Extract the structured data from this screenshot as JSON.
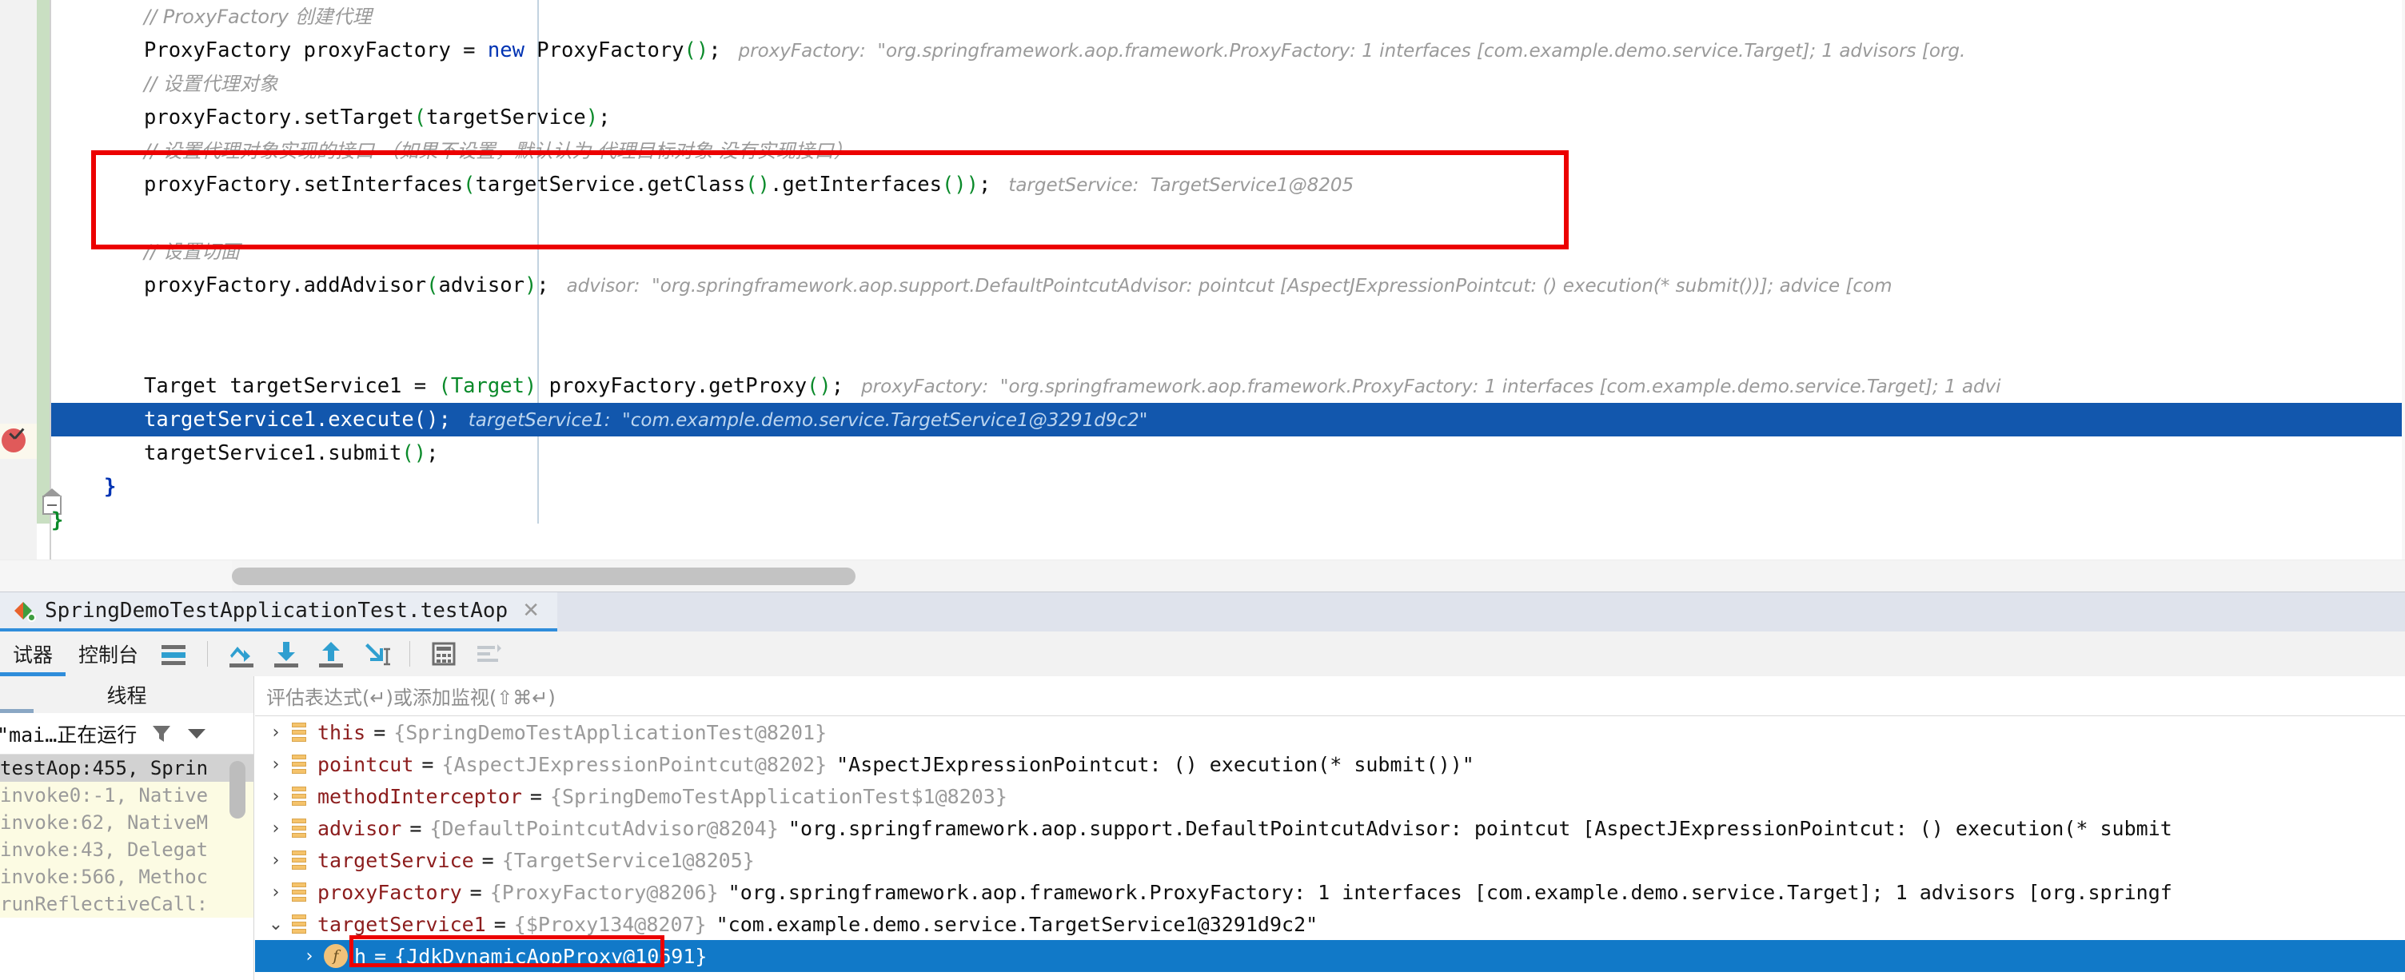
{
  "editor": {
    "lines": [
      {
        "indent": 0,
        "type": "comment",
        "text": "// ProxyFactory 创建代理"
      },
      {
        "indent": 0,
        "type": "code",
        "segments": [
          {
            "t": "plain",
            "v": "ProxyFactory proxyFactory = "
          },
          {
            "t": "kw",
            "v": "new"
          },
          {
            "t": "plain",
            "v": " ProxyFactory"
          },
          {
            "t": "paren",
            "v": "()"
          },
          {
            "t": "plain",
            "v": ";"
          }
        ],
        "hint": "proxyFactory:  \"org.springframework.aop.framework.ProxyFactory: 1 interfaces [com.example.demo.service.Target]; 1 advisors [org."
      },
      {
        "indent": 0,
        "type": "comment",
        "text": "// 设置代理对象"
      },
      {
        "indent": 0,
        "type": "code",
        "segments": [
          {
            "t": "plain",
            "v": "proxyFactory.setTarget"
          },
          {
            "t": "paren",
            "v": "("
          },
          {
            "t": "plain",
            "v": "targetService"
          },
          {
            "t": "paren",
            "v": ")"
          },
          {
            "t": "plain",
            "v": ";"
          }
        ],
        "hint": ""
      },
      {
        "indent": 0,
        "type": "comment",
        "text": "// 设置代理对象实现的接口 （如果不设置，默认认为 代理目标对象 没有实现接口）"
      },
      {
        "indent": 0,
        "type": "code",
        "segments": [
          {
            "t": "plain",
            "v": "proxyFactory.setInterfaces"
          },
          {
            "t": "paren",
            "v": "("
          },
          {
            "t": "plain",
            "v": "targetService.getClass"
          },
          {
            "t": "paren",
            "v": "()"
          },
          {
            "t": "plain",
            "v": ".getInterfaces"
          },
          {
            "t": "paren",
            "v": "()"
          },
          {
            "t": "paren",
            "v": ")"
          },
          {
            "t": "plain",
            "v": ";"
          }
        ],
        "hint": "targetService:  TargetService1@8205"
      },
      {
        "indent": 0,
        "type": "blank",
        "text": ""
      },
      {
        "indent": 0,
        "type": "comment",
        "text": "// 设置切面"
      },
      {
        "indent": 0,
        "type": "code",
        "segments": [
          {
            "t": "plain",
            "v": "proxyFactory.addAdvisor"
          },
          {
            "t": "paren",
            "v": "("
          },
          {
            "t": "plain",
            "v": "advisor"
          },
          {
            "t": "paren",
            "v": ")"
          },
          {
            "t": "plain",
            "v": ";"
          }
        ],
        "hint": "advisor:  \"org.springframework.aop.support.DefaultPointcutAdvisor: pointcut [AspectJExpressionPointcut: () execution(* submit())]; advice [com"
      },
      {
        "indent": 0,
        "type": "blank",
        "text": ""
      },
      {
        "indent": 0,
        "type": "blank",
        "text": ""
      },
      {
        "indent": 0,
        "type": "code",
        "segments": [
          {
            "t": "plain",
            "v": "Target targetService1 = "
          },
          {
            "t": "paren",
            "v": "(Target)"
          },
          {
            "t": "plain",
            "v": " proxyFactory.getProxy"
          },
          {
            "t": "paren",
            "v": "()"
          },
          {
            "t": "plain",
            "v": ";"
          }
        ],
        "hint": "proxyFactory:  \"org.springframework.aop.framework.ProxyFactory: 1 interfaces [com.example.demo.service.Target]; 1 advi"
      },
      {
        "indent": 0,
        "type": "code",
        "selected": true,
        "segments": [
          {
            "t": "plain",
            "v": "targetService1.execute"
          },
          {
            "t": "paren",
            "v": "()"
          },
          {
            "t": "plain",
            "v": ";"
          }
        ],
        "hint": "targetService1:  \"com.example.demo.service.TargetService1@3291d9c2\""
      },
      {
        "indent": 0,
        "type": "code",
        "segments": [
          {
            "t": "plain",
            "v": "targetService1.submit"
          },
          {
            "t": "paren",
            "v": "()"
          },
          {
            "t": "plain",
            "v": ";"
          }
        ],
        "hint": ""
      },
      {
        "indent": 0,
        "type": "brace-blue",
        "text": "}"
      },
      {
        "indent": 0,
        "type": "brace-green",
        "text": "}"
      }
    ],
    "highlight_box": "setInterfaces-annotation-box"
  },
  "debug_window": {
    "session_tab": {
      "label": "SpringDemoTestApplicationTest.testAop",
      "close": "✕",
      "icon": "debug-session-icon"
    },
    "toolbar": {
      "tabs": [
        {
          "label": "试器",
          "active": true,
          "name": "debugger"
        },
        {
          "label": "控制台",
          "active": false,
          "name": "console"
        }
      ],
      "buttons": [
        {
          "name": "show-execution-point-icon",
          "title": "show-execution-point"
        },
        {
          "name": "step-over-icon",
          "title": "step-over"
        },
        {
          "name": "step-into-icon",
          "title": "step-into"
        },
        {
          "name": "step-out-icon",
          "title": "step-out"
        },
        {
          "name": "force-step-into-icon",
          "title": "force-step-into"
        },
        {
          "name": "evaluate-expression-icon",
          "title": "evaluate-expression"
        },
        {
          "name": "sort-values-icon",
          "title": "sort-values"
        }
      ]
    },
    "threads": {
      "header": "线程",
      "selected_thread": "\"mai…正在运行",
      "filter_icon": "funnel-icon",
      "dropdown_icon": "chevron-down-icon",
      "frames": [
        {
          "text": "testAop:455, Sprin",
          "state": "current"
        },
        {
          "text": "invoke0:-1, Native",
          "state": "lib"
        },
        {
          "text": "invoke:62, NativeM",
          "state": "lib"
        },
        {
          "text": "invoke:43, Delegat",
          "state": "lib"
        },
        {
          "text": "invoke:566, Methoc",
          "state": "lib"
        },
        {
          "text": "runReflectiveCall:",
          "state": "lib"
        }
      ]
    },
    "variables": {
      "watch_placeholder": "评估表达式(↵)或添加监视(⇧⌘↵)",
      "rows": [
        {
          "twisty": "›",
          "icon": "field-icon",
          "name": "this",
          "eq": "=",
          "type": "{SpringDemoTestApplicationTest@8201}",
          "str": ""
        },
        {
          "twisty": "›",
          "icon": "field-icon",
          "name": "pointcut",
          "eq": "=",
          "type": "{AspectJExpressionPointcut@8202}",
          "str": "\"AspectJExpressionPointcut: () execution(* submit())\""
        },
        {
          "twisty": "›",
          "icon": "field-icon",
          "name": "methodInterceptor",
          "eq": "=",
          "type": "{SpringDemoTestApplicationTest$1@8203}",
          "str": ""
        },
        {
          "twisty": "›",
          "icon": "field-icon",
          "name": "advisor",
          "eq": "=",
          "type": "{DefaultPointcutAdvisor@8204}",
          "str": "\"org.springframework.aop.support.DefaultPointcutAdvisor: pointcut [AspectJExpressionPointcut: () execution(* submit"
        },
        {
          "twisty": "›",
          "icon": "field-icon",
          "name": "targetService",
          "eq": "=",
          "type": "{TargetService1@8205}",
          "str": ""
        },
        {
          "twisty": "›",
          "icon": "field-icon",
          "name": "proxyFactory",
          "eq": "=",
          "type": "{ProxyFactory@8206}",
          "str": "\"org.springframework.aop.framework.ProxyFactory: 1 interfaces [com.example.demo.service.Target]; 1 advisors [org.springf"
        },
        {
          "twisty": "⌄",
          "icon": "field-icon",
          "name": "targetService1",
          "eq": "=",
          "type": "{$Proxy134@8207}",
          "str": "\"com.example.demo.service.TargetService1@3291d9c2\""
        },
        {
          "twisty": "›",
          "icon": "f-circle",
          "child": true,
          "selected": true,
          "name": "h",
          "eq": "=",
          "type": "{JdkDynamicAopProxy@10691}",
          "str": ""
        }
      ],
      "highlight_box": "h-variable-box"
    }
  },
  "colors": {
    "selection_blue": "#1257ad",
    "row_selection_blue": "#1179c8",
    "highlight_red": "#ec0000",
    "accent_blue": "#2f8ddb",
    "changed_green": "#c9dfc2",
    "var_name_red": "#8c1d1d"
  }
}
